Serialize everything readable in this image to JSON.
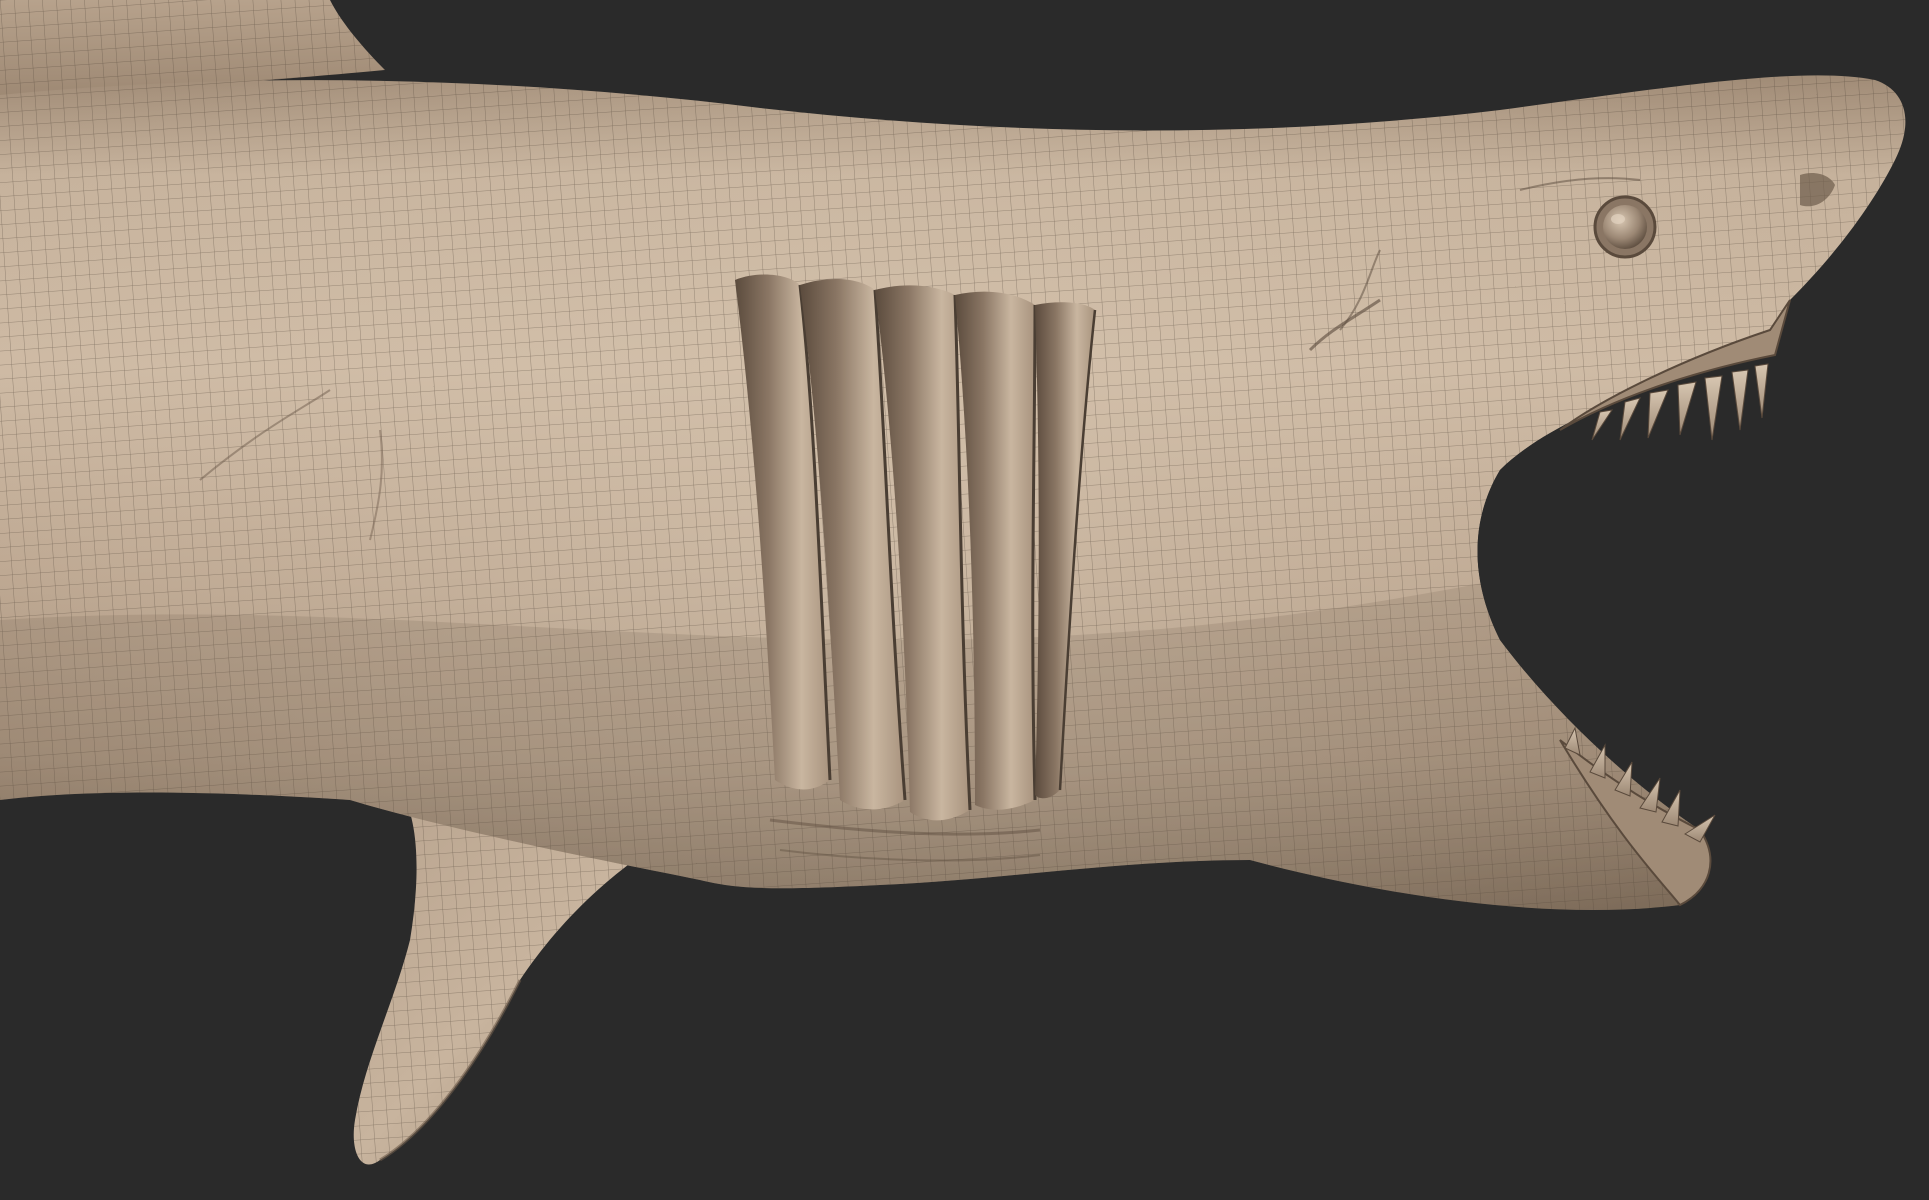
{
  "viewport": {
    "background_color": "#2a2a2a"
  },
  "model": {
    "subject": "shark",
    "base_color": "#bba58f",
    "highlight_color": "#d6c4ae",
    "shadow_color": "#6e5c4b",
    "wire_color": "#4a3e33",
    "gill_slit_count": 5,
    "visible_parts": [
      "body",
      "dorsal-fin",
      "pectoral-fin",
      "gill-slits",
      "eye",
      "upper-jaw",
      "lower-jaw",
      "upper-teeth",
      "lower-teeth",
      "wireframe-overlay"
    ]
  }
}
